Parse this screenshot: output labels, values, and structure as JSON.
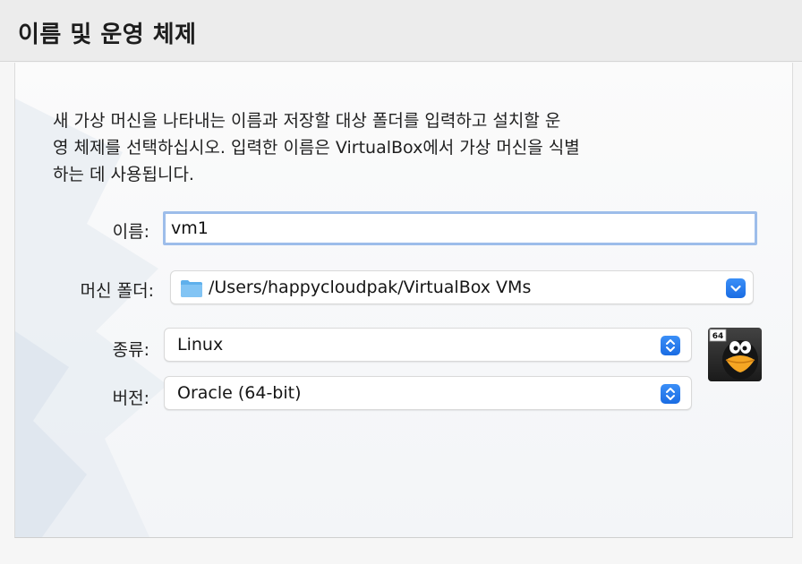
{
  "title": "이름 및 운영 체제",
  "description": {
    "line1": "새 가상 머신을 나타내는 이름과 저장할 대상 폴더를 입력하고 설치할 운",
    "line2": "영 체제를 선택하십시오. 입력한 이름은 VirtualBox에서 가상 머신을 식별",
    "line3": "하는 데 사용됩니다."
  },
  "fields": {
    "name_label": "이름:",
    "name_value": "vm1",
    "folder_label": "머신 폴더:",
    "folder_value": "/Users/happycloudpak/VirtualBox VMs",
    "type_label": "종류:",
    "type_value": "Linux",
    "version_label": "버전:",
    "version_value": "Oracle (64-bit)"
  },
  "os_icon": {
    "name": "linux-64-penguin-icon",
    "badge": "64"
  },
  "colors": {
    "accent": "#1a6ce3",
    "focus_ring": "#9dbdea"
  }
}
